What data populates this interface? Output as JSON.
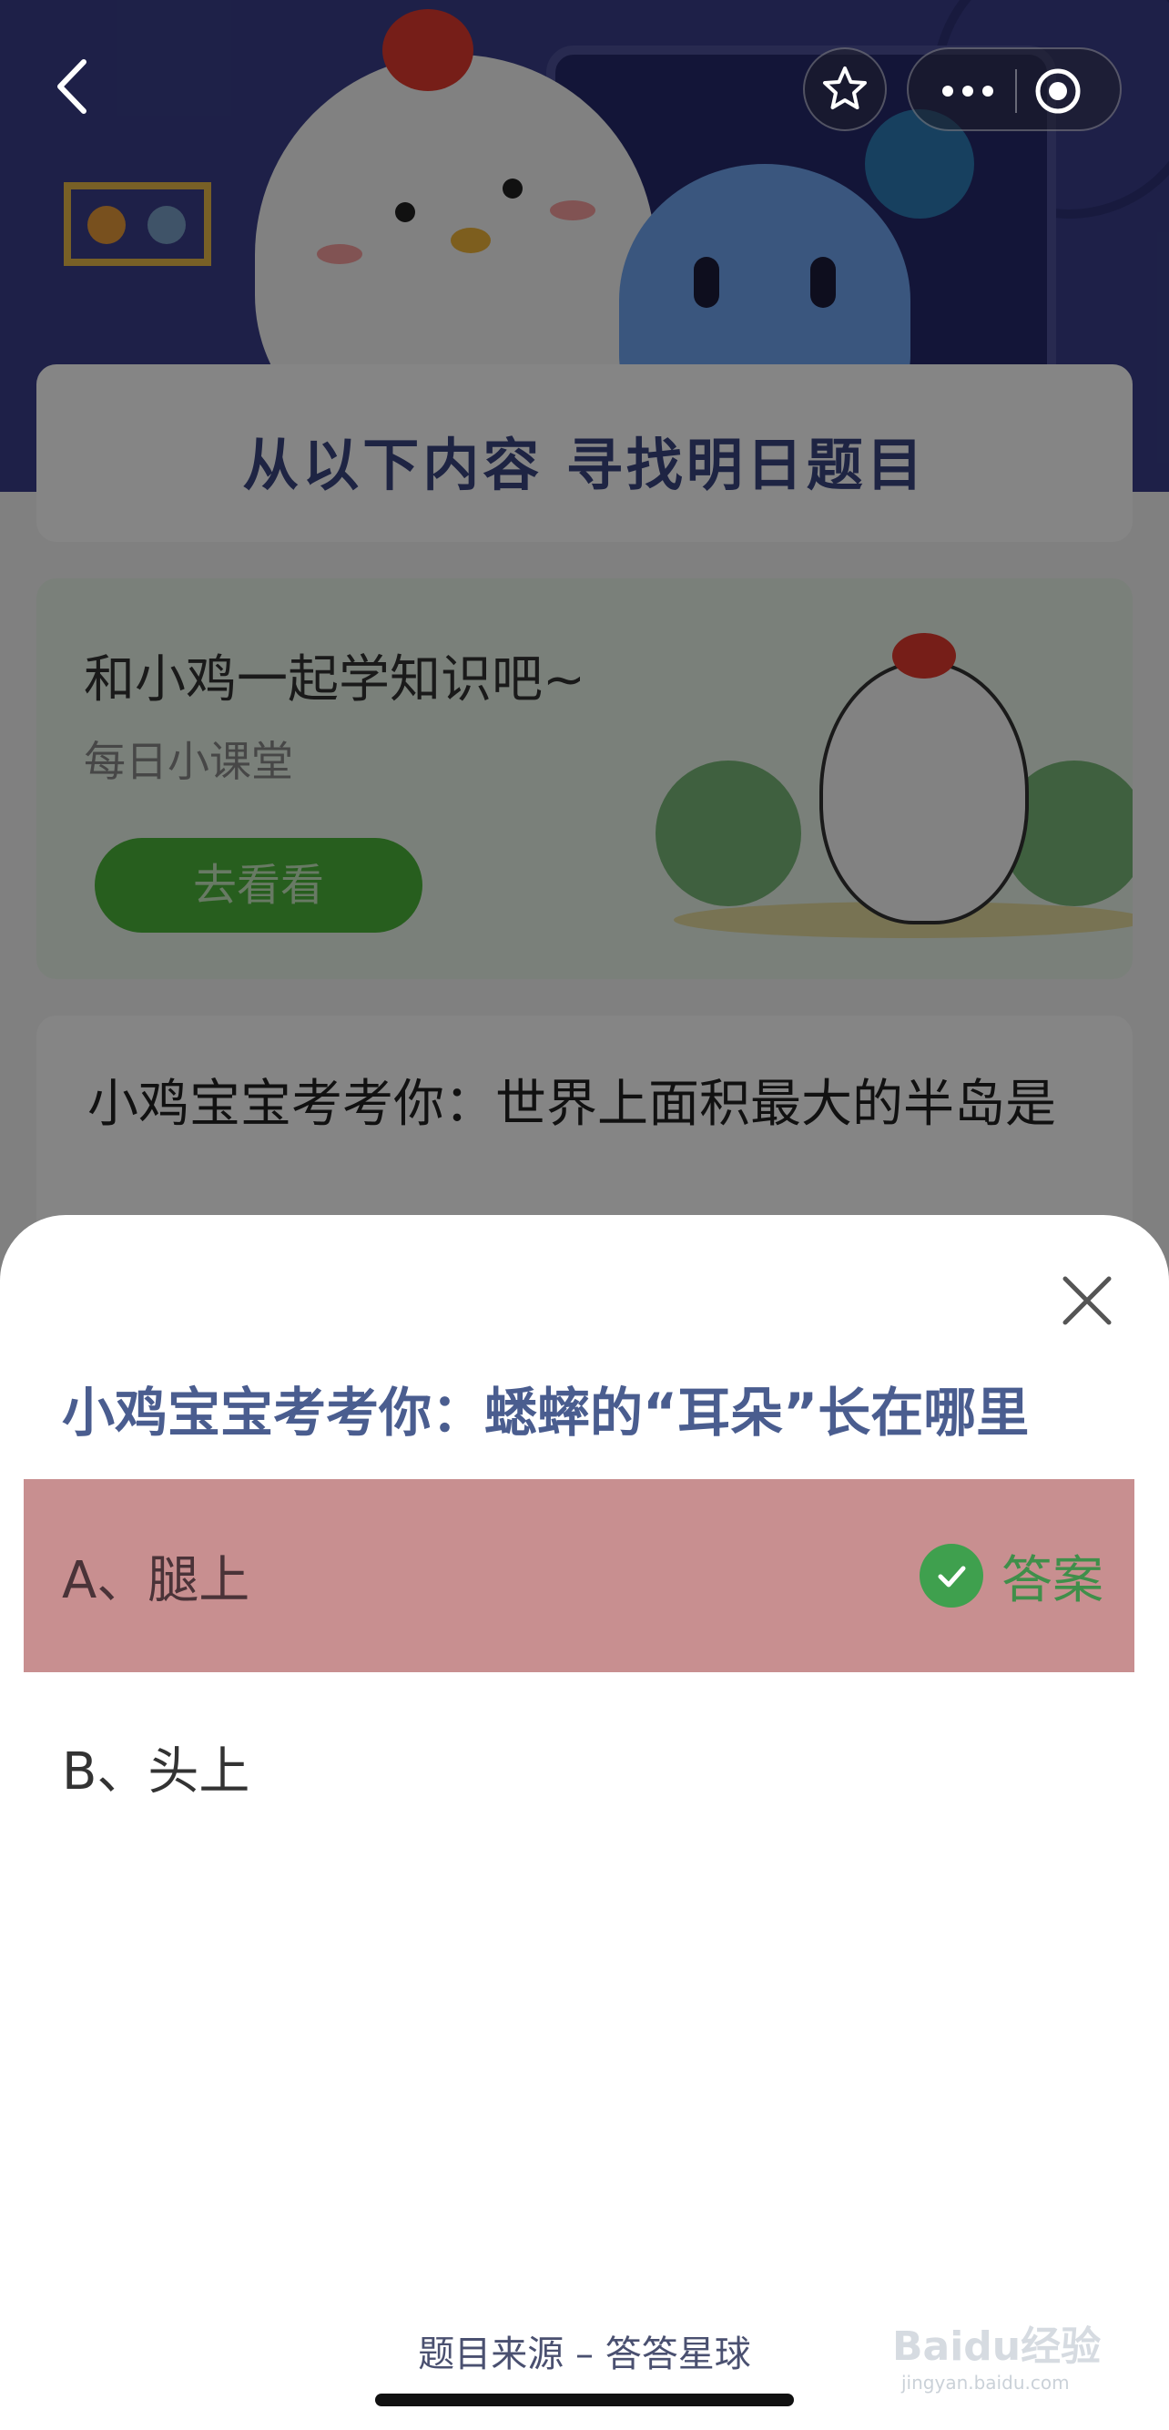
{
  "background": {
    "topic_banner": "从以下内容 寻找明日题目",
    "learn_card": {
      "title": "和小鸡一起学知识吧~",
      "subtitle": "每日小课堂",
      "button_label": "去看看"
    },
    "previous_quiz": {
      "question": "小鸡宝宝考考你：世界上面积最大的半岛是"
    }
  },
  "top_bar": {
    "back_icon": "chevron-left-icon",
    "star_icon": "star-icon",
    "more_icon": "more-dots-icon",
    "close_icon": "target-circle-icon"
  },
  "sheet": {
    "question": "小鸡宝宝考考你：蟋蟀的“耳朵”长在哪里",
    "options": [
      {
        "label": "A、腿上",
        "is_answer": true
      },
      {
        "label": "B、头上",
        "is_answer": false
      }
    ],
    "answer_label": "答案",
    "source": "题目来源 – 答答星球"
  },
  "watermark": {
    "text": "Baidu经验",
    "sub": "jingyan.baidu.com"
  },
  "colors": {
    "correct_bg": "#c88f90",
    "check_green": "#3fa04e",
    "question_blue": "#4a5d8f"
  }
}
